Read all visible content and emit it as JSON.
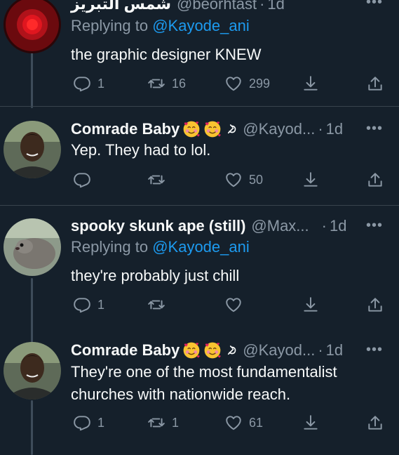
{
  "tweets": [
    {
      "name": "شمس التبريز",
      "handle": "@beorhtast",
      "time": "1d",
      "reply_prefix": "Replying to",
      "reply_to": "@Kayode_ani",
      "text": "the graphic designer KNEW",
      "replies": "1",
      "retweets": "16",
      "likes": "299"
    },
    {
      "name": "Comrade Baby",
      "handle": "@Kayod...",
      "time": "1d",
      "text": "Yep. They had to lol.",
      "replies": "",
      "retweets": "",
      "likes": "50"
    },
    {
      "name": "spooky skunk ape (still)",
      "handle": "@Max...",
      "time": "1d",
      "reply_prefix": "Replying to",
      "reply_to": "@Kayode_ani",
      "text": "they're probably just chill",
      "replies": "1",
      "retweets": "",
      "likes": ""
    },
    {
      "name": "Comrade Baby",
      "handle": "@Kayod...",
      "time": "1d",
      "text_lines": [
        "They're one of the most fundamentalist",
        "churches with nationwide reach."
      ],
      "replies": "1",
      "retweets": "1",
      "likes": "61"
    }
  ],
  "emoji_icons": [
    "smiling-face-with-hearts-icon",
    "hammer-and-sickle-icon"
  ],
  "colors": {
    "background": "#15202b",
    "link": "#1d9bf0",
    "muted": "#8b98a5"
  }
}
